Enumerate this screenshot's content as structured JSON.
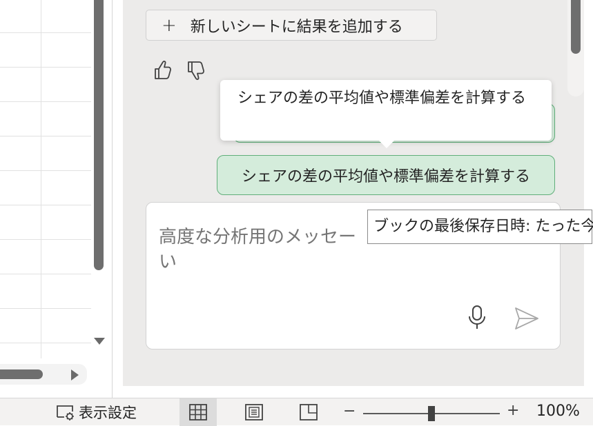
{
  "copilot": {
    "add_sheet_label": "新しいシートに結果を追加する",
    "suggestion_tooltip": "シェアの差の平均値や標準偏差を計算する",
    "suggestion_label": "シェアの差の平均値や標準偏差を計算する",
    "composer_placeholder": "高度な分析用のメッセージを入力してください",
    "composer_visible_line1": "高度な分析用のメッセー",
    "composer_visible_line2": "い",
    "icons": [
      "plus-icon",
      "thumbs-up-icon",
      "thumbs-down-icon",
      "microphone-icon",
      "send-icon"
    ]
  },
  "save_tooltip": "ブックの最後保存日時: たった今",
  "statusbar": {
    "display_settings_label": "表示設定",
    "views": [
      "normal-view-icon",
      "page-layout-view-icon",
      "page-break-preview-icon"
    ],
    "zoom_minus": "−",
    "zoom_plus": "+",
    "zoom_level": "100%",
    "zoom_fraction": 0.5
  },
  "colors": {
    "accent_green_fill": "#d4ecdb",
    "accent_green_border": "#5fae79",
    "pane_background": "#ecebea"
  }
}
